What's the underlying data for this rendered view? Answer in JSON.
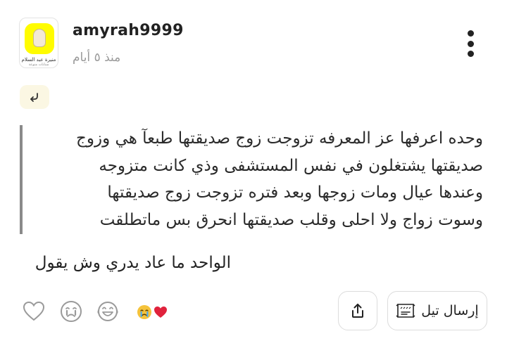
{
  "post": {
    "author": {
      "username": "amyrah9999",
      "avatar_caption": "منيرة عبد السلام",
      "avatar_subcaption": "سنابات منوعة"
    },
    "timestamp": "منذ ٥ أيام",
    "reply_icon": "reply-arrow-icon",
    "quoted_lines": [
      "وحده اعرفها عز المعرفه تزوجت زوج صديقتها طبعآ هي وزوج",
      "صديقتها يشتغلون في نفس المستشفى وذي كانت متزوجه",
      "وعندها عيال ومات زوجها وبعد فتره تزوجت زوج صديقتها",
      "وسوت زواج ولا احلى وقلب صديقتها انحرق بس ماتطلقت"
    ],
    "comment": "الواحد ما عاد يدري وش يقول"
  },
  "actions": {
    "share_icon": "share-icon",
    "send_label": "إرسال تيل",
    "send_icon": "tell-card-icon"
  },
  "colors": {
    "reply_badge_bg": "#fbf7e3",
    "quote_bar": "#8a8a8a",
    "heart": "#e0223c",
    "emoji_face": "#f5c33b"
  }
}
